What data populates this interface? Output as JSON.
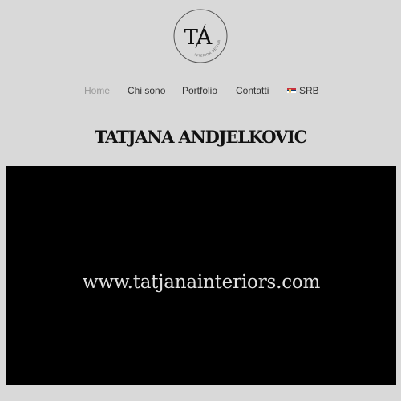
{
  "logo": {
    "monogram": "TA",
    "tagline": "INTERIOR DESIGN"
  },
  "nav": {
    "items": [
      {
        "label": "Home",
        "active": true
      },
      {
        "label": "Chi sono",
        "active": false
      },
      {
        "label": "Portfolio",
        "active": false
      },
      {
        "label": "Contatti",
        "active": false
      }
    ],
    "language": {
      "label": "SRB",
      "icon": "serbia-flag-icon"
    }
  },
  "header": {
    "title": "TATJANA ANDJELKOVIC"
  },
  "banner": {
    "text": "www.tatjanainteriors.com"
  },
  "colors": {
    "background": "#d9d9d9",
    "text": "#333333",
    "active_nav": "#9a9a9a",
    "banner_bg": "#000000",
    "banner_text": "#e0e0e0"
  }
}
